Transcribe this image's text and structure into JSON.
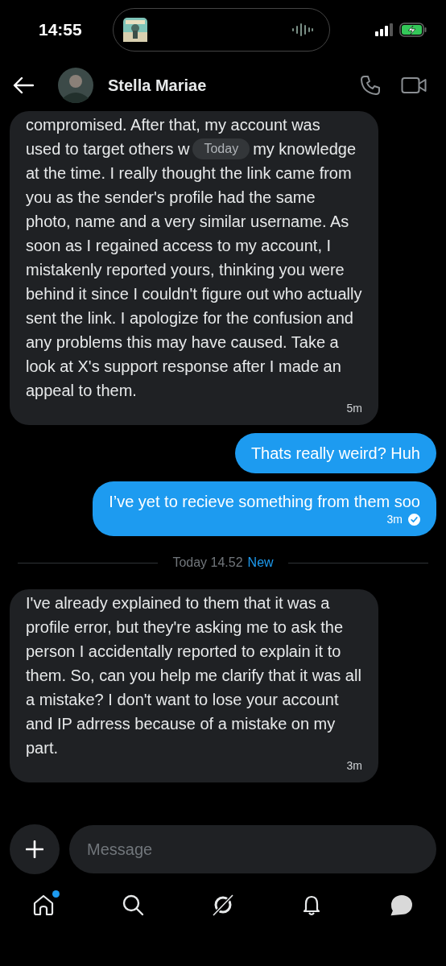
{
  "status_bar": {
    "time": "14:55"
  },
  "header": {
    "name": "Stella Mariae"
  },
  "messages": [
    {
      "kind": "received",
      "first_line": "compromised. After that, my account was",
      "covered_line": [
        "used to target others w",
        "my knowledge"
      ],
      "floating_label": "Today",
      "text": "at the time. I really thought the link came from you as the sender's profile had the same photo, name and a very similar username. As soon as I regained access to my account, I mistakenly reported yours, thinking you were behind it since I couldn't figure out who actually sent the link. I apologize for the confusion and any problems this may have caused. Take a look at X's support response after I made an appeal to them.",
      "time": "5m"
    },
    {
      "kind": "sent",
      "text": "Thats really weird? Huh"
    },
    {
      "kind": "sent",
      "text": "I’ve yet to recieve something from them soo",
      "time": "3m",
      "read": true
    },
    {
      "kind": "divider",
      "label": "Today 14.52",
      "badge": "New"
    },
    {
      "kind": "received",
      "text": "I've already explained to them that it was a profile error, but they're asking me to ask the person I accidentally reported to explain it to them. So, can you help me clarify that it was all a mistake? I don't want to lose your account and IP adrress because of a mistake on my part.",
      "time": "3m"
    }
  ],
  "composer": {
    "placeholder": "Message"
  },
  "nav": [
    {
      "kind": "home",
      "selected": false,
      "badge": true
    },
    {
      "kind": "search",
      "selected": false,
      "badge": false
    },
    {
      "kind": "grok",
      "selected": false,
      "badge": false
    },
    {
      "kind": "bell",
      "selected": false,
      "badge": false
    },
    {
      "kind": "messages",
      "selected": true,
      "badge": false
    }
  ]
}
